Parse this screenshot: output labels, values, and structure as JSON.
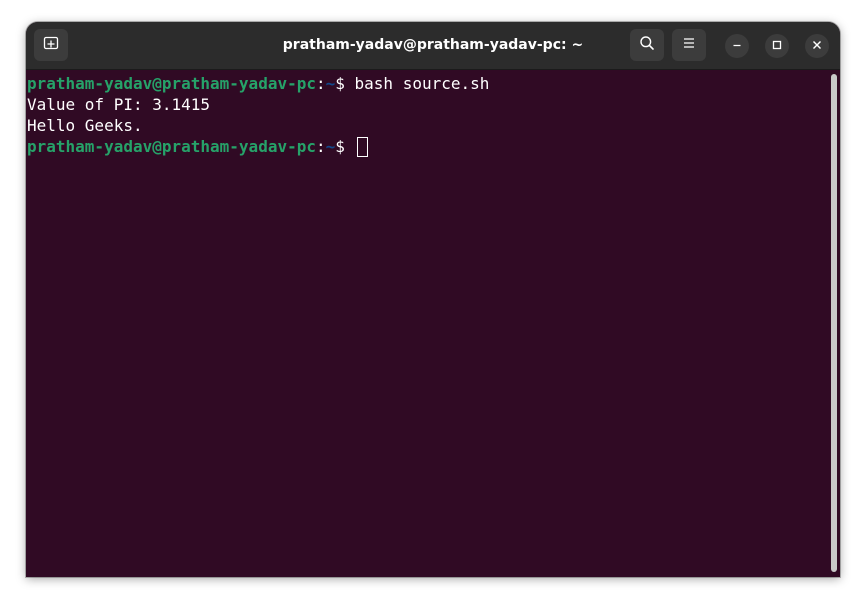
{
  "window": {
    "title": "pratham-yadav@pratham-yadav-pc: ~"
  },
  "titlebar": {
    "new_tab_icon": "new-tab-icon",
    "search_icon": "search-icon",
    "menu_icon": "hamburger-menu-icon",
    "minimize_icon": "minimize-icon",
    "maximize_icon": "maximize-icon",
    "close_icon": "close-icon"
  },
  "terminal": {
    "lines": [
      {
        "user": "pratham-yadav@pratham-yadav-pc",
        "colon": ":",
        "path": "~",
        "prompt": "$ ",
        "command": "bash source.sh"
      },
      {
        "text": "Value of PI: 3.1415"
      },
      {
        "text": "Hello Geeks."
      },
      {
        "user": "pratham-yadav@pratham-yadav-pc",
        "colon": ":",
        "path": "~",
        "prompt": "$ ",
        "command": ""
      }
    ]
  },
  "colors": {
    "background": "#300a24",
    "user_host": "#26a269",
    "path": "#12488b",
    "titlebar": "#2c2c2c"
  }
}
